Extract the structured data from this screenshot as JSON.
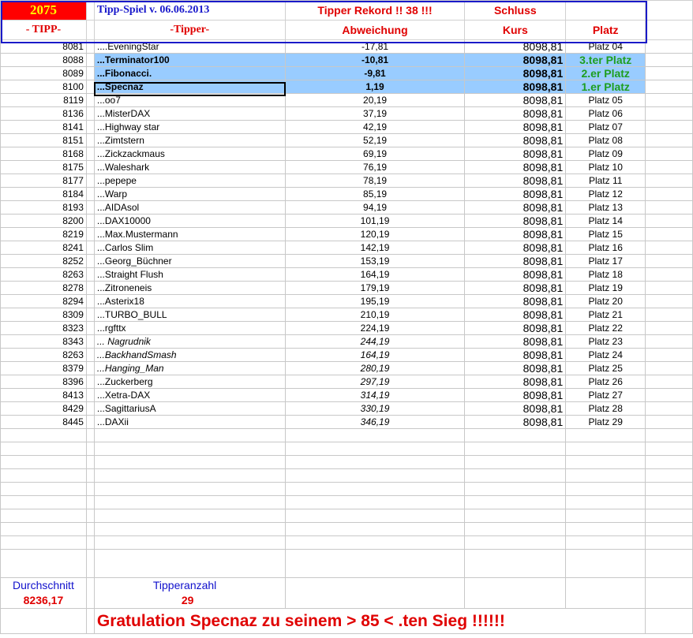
{
  "header": {
    "tipp_number": "2075",
    "title": "Tipp-Spiel v. 06.06.2013",
    "record": "Tipper Rekord !!  38  !!!",
    "schluss": "Schluss",
    "col_tipp": "- TIPP-",
    "col_tipper": "-Tipper-",
    "col_abweichung": "Abweichung",
    "col_kurs": "Kurs",
    "col_platz": "Platz"
  },
  "rows": [
    {
      "tipp": "8081",
      "name": "....EveningStar",
      "abw": "-17,81",
      "kurs": "8098,81",
      "platz": "Platz 04"
    },
    {
      "tipp": "8088",
      "name": "...Terminator100",
      "abw": "-10,81",
      "kurs": "8098,81",
      "platz": "3.ter Platz"
    },
    {
      "tipp": "8089",
      "name": "...Fibonacci.",
      "abw": "-9,81",
      "kurs": "8098,81",
      "platz": "2.er Platz"
    },
    {
      "tipp": "8100",
      "name": "...Specnaz",
      "abw": "1,19",
      "kurs": "8098,81",
      "platz": "1.er Platz"
    },
    {
      "tipp": "8119",
      "name": "...oo7",
      "abw": "20,19",
      "kurs": "8098,81",
      "platz": "Platz 05"
    },
    {
      "tipp": "8136",
      "name": "...MisterDAX",
      "abw": "37,19",
      "kurs": "8098,81",
      "platz": "Platz 06"
    },
    {
      "tipp": "8141",
      "name": "...Highway star",
      "abw": "42,19",
      "kurs": "8098,81",
      "platz": "Platz 07"
    },
    {
      "tipp": "8151",
      "name": "...Zimtstern",
      "abw": "52,19",
      "kurs": "8098,81",
      "platz": "Platz 08"
    },
    {
      "tipp": "8168",
      "name": "...Zickzackmaus",
      "abw": "69,19",
      "kurs": "8098,81",
      "platz": "Platz 09"
    },
    {
      "tipp": "8175",
      "name": "...Waleshark",
      "abw": "76,19",
      "kurs": "8098,81",
      "platz": "Platz 10"
    },
    {
      "tipp": "8177",
      "name": "...pepepe",
      "abw": "78,19",
      "kurs": "8098,81",
      "platz": "Platz 11"
    },
    {
      "tipp": "8184",
      "name": "...Warp",
      "abw": "85,19",
      "kurs": "8098,81",
      "platz": "Platz 12"
    },
    {
      "tipp": "8193",
      "name": "...AIDAsol",
      "abw": "94,19",
      "kurs": "8098,81",
      "platz": "Platz 13"
    },
    {
      "tipp": "8200",
      "name": "...DAX10000",
      "abw": "101,19",
      "kurs": "8098,81",
      "platz": "Platz 14"
    },
    {
      "tipp": "8219",
      "name": "...Max.Mustermann",
      "abw": "120,19",
      "kurs": "8098,81",
      "platz": "Platz 15"
    },
    {
      "tipp": "8241",
      "name": "...Carlos Slim",
      "abw": "142,19",
      "kurs": "8098,81",
      "platz": "Platz 16"
    },
    {
      "tipp": "8252",
      "name": "...Georg_Büchner",
      "abw": "153,19",
      "kurs": "8098,81",
      "platz": "Platz 17"
    },
    {
      "tipp": "8263",
      "name": "...Straight Flush",
      "abw": "164,19",
      "kurs": "8098,81",
      "platz": "Platz 18"
    },
    {
      "tipp": "8278",
      "name": "...Zitroneneis",
      "abw": "179,19",
      "kurs": "8098,81",
      "platz": "Platz 19"
    },
    {
      "tipp": "8294",
      "name": "...Asterix18",
      "abw": "195,19",
      "kurs": "8098,81",
      "platz": "Platz 20"
    },
    {
      "tipp": "8309",
      "name": "...TURBO_BULL",
      "abw": "210,19",
      "kurs": "8098,81",
      "platz": "Platz 21"
    },
    {
      "tipp": "8323",
      "name": "...rgfttx",
      "abw": "224,19",
      "kurs": "8098,81",
      "platz": "Platz 22"
    },
    {
      "tipp": "8343",
      "name": "... Nagrudnik",
      "abw": "244,19",
      "kurs": "8098,81",
      "platz": "Platz 23"
    },
    {
      "tipp": "8263",
      "name": "...BackhandSmash",
      "abw": "164,19",
      "kurs": "8098,81",
      "platz": "Platz 24"
    },
    {
      "tipp": "8379",
      "name": "...Hanging_Man",
      "abw": "280,19",
      "kurs": "8098,81",
      "platz": "Platz 25"
    },
    {
      "tipp": "8396",
      "name": "...Zuckerberg",
      "abw": "297,19",
      "kurs": "8098,81",
      "platz": "Platz 26"
    },
    {
      "tipp": "8413",
      "name": "...Xetra-DAX",
      "abw": "314,19",
      "kurs": "8098,81",
      "platz": "Platz 27"
    },
    {
      "tipp": "8429",
      "name": "...SagittariusA",
      "abw": "330,19",
      "kurs": "8098,81",
      "platz": "Platz 28"
    },
    {
      "tipp": "8445",
      "name": "...DAXii",
      "abw": "346,19",
      "kurs": "8098,81",
      "platz": "Platz 29"
    }
  ],
  "footer": {
    "durchschnitt_label": "Durchschnitt",
    "durchschnitt_value": "8236,17",
    "tipperanzahl_label": "Tipperanzahl",
    "tipperanzahl_value": "29",
    "gratulation": "Gratulation Specnaz  zu seinem > 85 < .ten Sieg !!!!!!"
  }
}
